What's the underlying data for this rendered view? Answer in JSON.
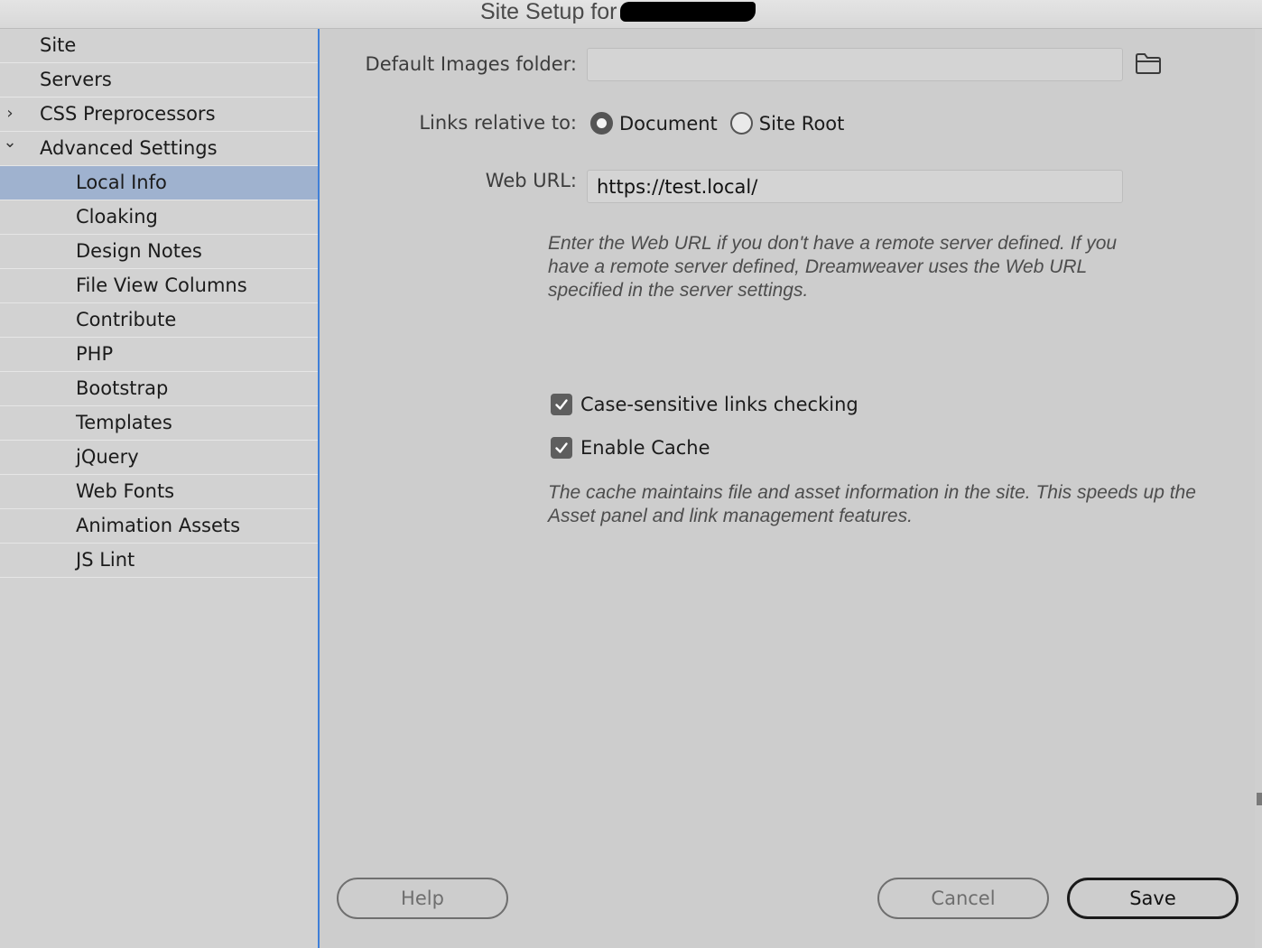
{
  "window": {
    "title": "Site Setup for"
  },
  "sidebar": {
    "items": [
      {
        "label": "Site",
        "chevron": ""
      },
      {
        "label": "Servers",
        "chevron": ""
      },
      {
        "label": "CSS Preprocessors",
        "chevron": "›"
      },
      {
        "label": "Advanced Settings",
        "chevron": "⌄"
      },
      {
        "label": "Local Info"
      },
      {
        "label": "Cloaking"
      },
      {
        "label": "Design Notes"
      },
      {
        "label": "File View Columns"
      },
      {
        "label": "Contribute"
      },
      {
        "label": "PHP"
      },
      {
        "label": "Bootstrap"
      },
      {
        "label": "Templates"
      },
      {
        "label": "jQuery"
      },
      {
        "label": "Web Fonts"
      },
      {
        "label": "Animation Assets"
      },
      {
        "label": "JS Lint"
      }
    ],
    "selected": "Local Info"
  },
  "main": {
    "images_folder": {
      "label": "Default Images folder:",
      "value": "",
      "browse_icon": "folder-icon"
    },
    "links_relative": {
      "label": "Links relative to:",
      "options": [
        "Document",
        "Site Root"
      ],
      "selected": "Document"
    },
    "web_url": {
      "label": "Web URL:",
      "value": "https://test.local/",
      "help": "Enter the Web URL if you don't have a remote server defined. If you have a remote server defined, Dreamweaver uses the Web URL specified in the server settings."
    },
    "case_sensitive": {
      "label": "Case-sensitive links checking",
      "checked": true
    },
    "enable_cache": {
      "label": "Enable Cache",
      "checked": true,
      "help": "The cache maintains file and asset information in the site. This speeds up the Asset panel and link management features."
    }
  },
  "buttons": {
    "help": "Help",
    "cancel": "Cancel",
    "save": "Save"
  }
}
